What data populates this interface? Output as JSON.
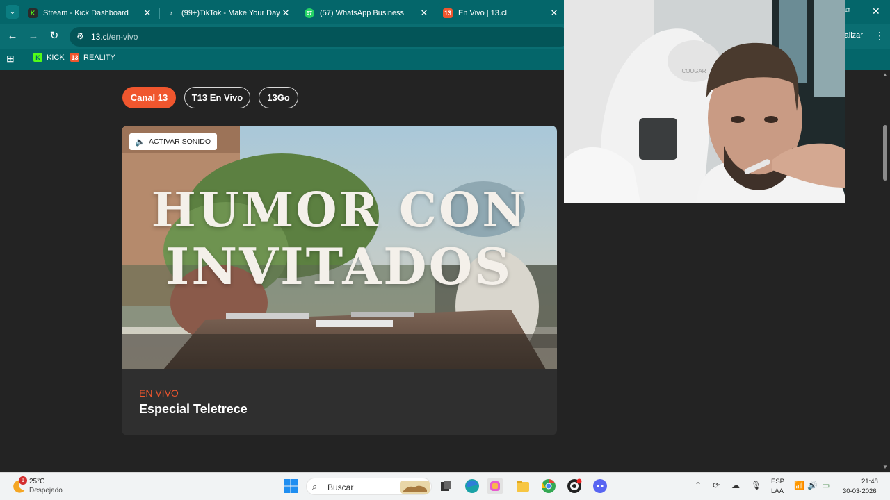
{
  "browser": {
    "tabs": [
      {
        "title": "Stream - Kick Dashboard",
        "favicon": "kick-icon",
        "active": false
      },
      {
        "title": "(99+)TikTok - Make Your Day",
        "favicon": "tiktok-icon",
        "active": false
      },
      {
        "title": "(57) WhatsApp Business",
        "favicon": "whatsapp-icon",
        "active": false
      },
      {
        "title": "En Vivo | 13.cl",
        "favicon": "canal13-icon",
        "active": true
      }
    ],
    "whatsapp_badge": "57",
    "url_host": "13.cl",
    "url_path": "/en-vivo",
    "update_label": "ctualizar",
    "bookmarks": [
      {
        "label": "KICK",
        "icon": "kick-icon"
      },
      {
        "label": "REALITY",
        "icon": "canal13-icon"
      }
    ],
    "colors": {
      "frame": "#04666a",
      "omnibox": "#035558"
    }
  },
  "page": {
    "channels": [
      {
        "label": "Canal 13",
        "selected": true
      },
      {
        "label": "T13 En Vivo",
        "selected": false
      },
      {
        "label": "13Go",
        "selected": false
      }
    ],
    "player": {
      "sound_button": "ACTIVAR SONIDO",
      "video_title_line1": "HUMOR CON",
      "video_title_line2": "INVITADOS"
    },
    "live_tag": "EN VIVO",
    "program_title": "Especial Teletrece",
    "colors": {
      "accent": "#f0562e",
      "background": "#232323",
      "card": "#2f2f2f"
    }
  },
  "webcam": {
    "chair_brand": "COUGAR"
  },
  "taskbar": {
    "weather": {
      "badge": "1",
      "temp": "25°C",
      "desc": "Despejado"
    },
    "search_placeholder": "Buscar",
    "apps": [
      "windows-start-icon",
      "task-view-icon",
      "edge-icon",
      "copilot-icon",
      "file-explorer-icon",
      "chrome-icon",
      "obs-icon",
      "discord-icon"
    ],
    "lang_line1": "ESP",
    "lang_line2": "LAA",
    "time": "21:48",
    "date": "30-03-2026"
  }
}
